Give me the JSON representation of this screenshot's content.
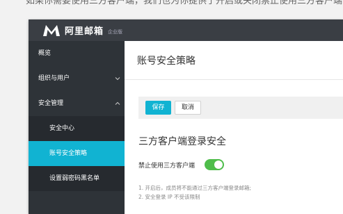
{
  "doc": {
    "top_text": "如果你需要使用三方客户端，我们也为你提供了开启或关闭禁止使用三方客户端"
  },
  "app": {
    "logo_text": "阿里邮箱",
    "edition": "企业版"
  },
  "sidebar": {
    "items": [
      {
        "label": "概览"
      },
      {
        "label": "组织与用户"
      },
      {
        "label": "安全管理"
      },
      {
        "label": "安全中心"
      },
      {
        "label": "账号安全策略"
      },
      {
        "label": "设置弱密码黑名单"
      }
    ]
  },
  "main": {
    "page_title": "账号安全策略",
    "save_label": "保存",
    "cancel_label": "取消",
    "section_title": "三方客户端登录安全",
    "setting_label": "禁止使用三方客户端",
    "toggle_on": true,
    "notes": [
      "1. 开启后，成员将不能通过三方客户端登录邮箱;",
      "2. 安全登录 IP 不受该限制"
    ]
  },
  "colors": {
    "accent": "#11b3d2",
    "sidebar_bg": "#2e3338",
    "topbar_bg": "#3a3e44",
    "toggle_on": "#4fbd4b"
  }
}
